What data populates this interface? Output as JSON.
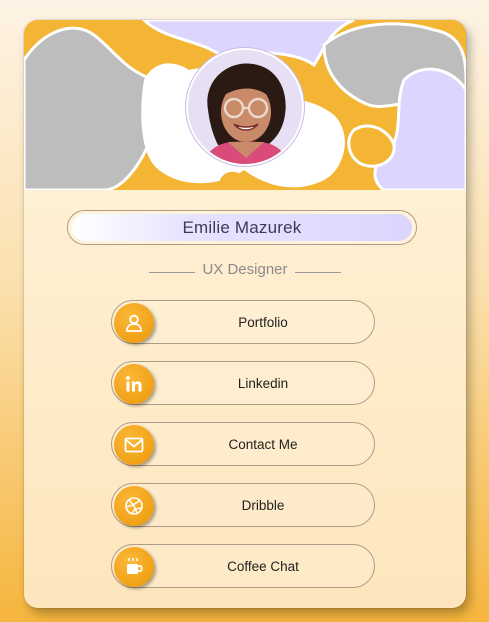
{
  "profile": {
    "name": "Emilie Mazurek",
    "role": "UX Designer",
    "avatar_icon": "profile-photo"
  },
  "links": [
    {
      "label": "Portfolio",
      "icon": "user-icon"
    },
    {
      "label": "Linkedin",
      "icon": "linkedin-icon"
    },
    {
      "label": "Contact Me",
      "icon": "mail-icon"
    },
    {
      "label": "Dribble",
      "icon": "dribbble-icon"
    },
    {
      "label": "Coffee Chat",
      "icon": "coffee-icon"
    }
  ],
  "colors": {
    "accent": "#f4a82a",
    "lavender": "#dcd6ff",
    "gray_blob": "#bdbdbd"
  }
}
